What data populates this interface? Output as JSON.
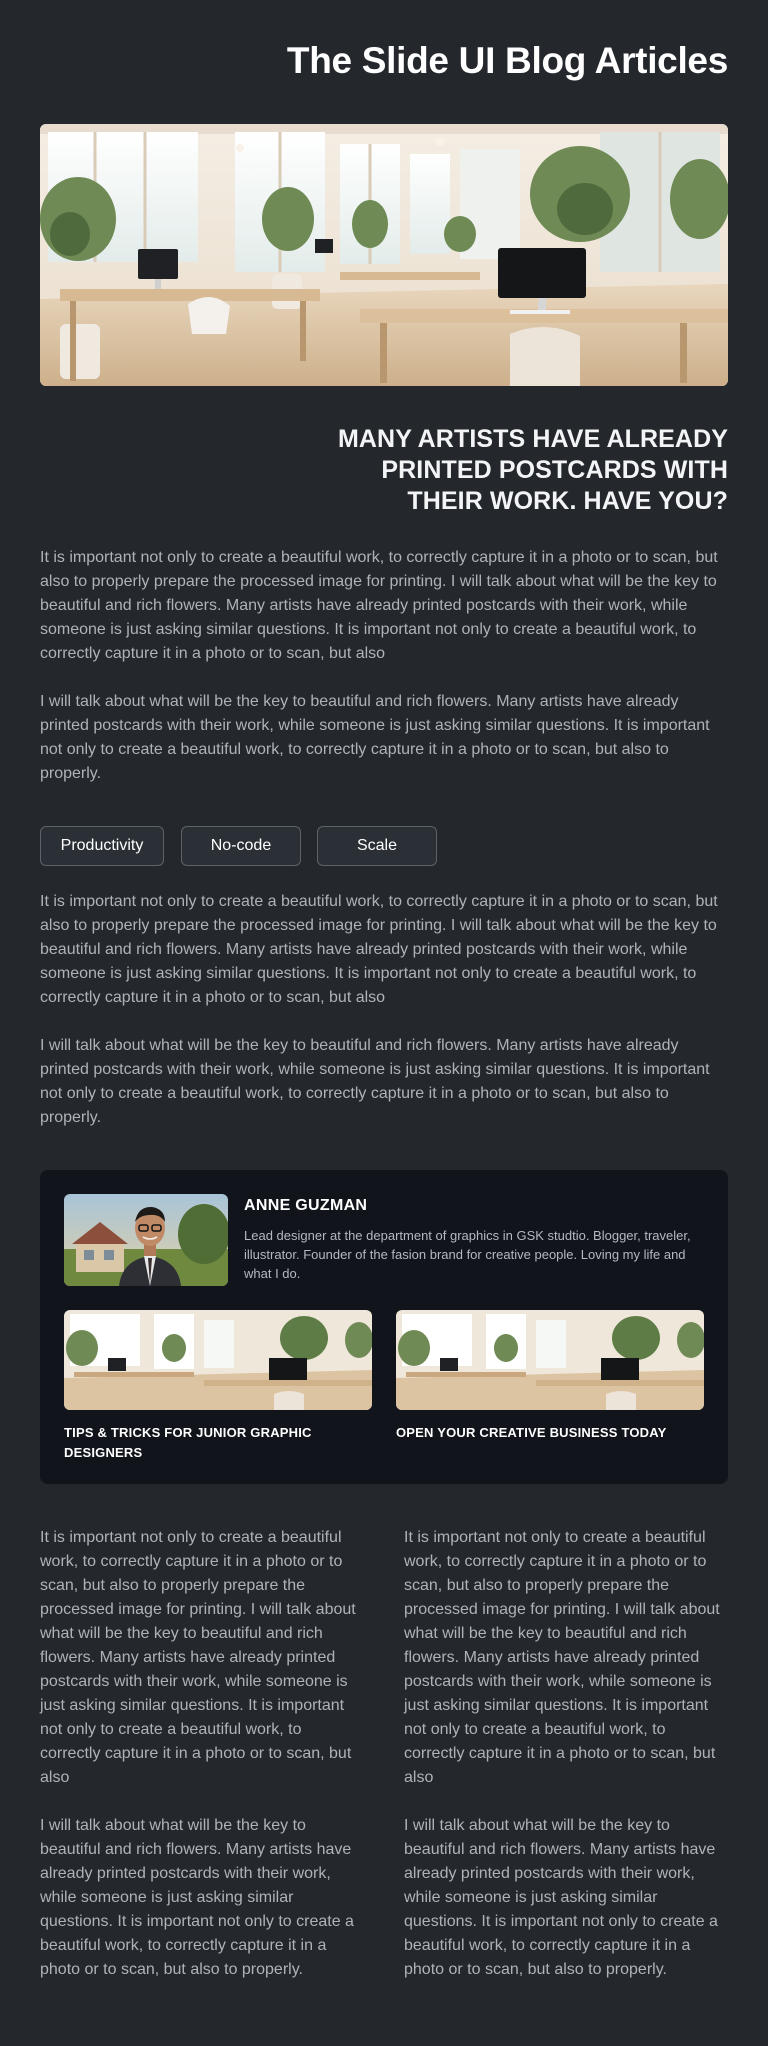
{
  "header": {
    "title": "The Slide UI Blog Articles"
  },
  "hero": {
    "image_name": "office-interior"
  },
  "article": {
    "heading": "MANY ARTISTS HAVE ALREADY PRINTED POSTCARDS WITH THEIR WORK. HAVE YOU?",
    "para1": "It is important not only to create a beautiful work, to correctly capture it in a photo or to scan, but also to properly prepare the processed image for printing. I will talk about what will be the key to beautiful and rich flowers. Many artists have already printed postcards with their work, while someone is just asking similar questions. It is important not only to create a beautiful work, to correctly capture it in a photo or to scan, but also",
    "para2": "I will talk about what will be the key to beautiful and rich flowers. Many artists have already printed postcards with their work, while someone is just asking similar questions. It is important not only to create a beautiful work, to correctly capture it in a photo or to scan, but also to properly.",
    "tags": [
      "Productivity",
      "No-code",
      "Scale"
    ],
    "para3": "It is important not only to create a beautiful work, to correctly capture it in a photo or to scan, but also to properly prepare the processed image for printing. I will talk about what will be the key to beautiful and rich flowers. Many artists have already printed postcards with their work, while someone is just asking similar questions. It is important not only to create a beautiful work, to correctly capture it in a photo or to scan, but also",
    "para4": "I will talk about what will be the key to beautiful and rich flowers. Many artists have already printed postcards with their work, while someone is just asking similar questions. It is important not only to create a beautiful work, to correctly capture it in a photo or to scan, but also to properly."
  },
  "author_card": {
    "name": "ANNE GUZMAN",
    "bio": "Lead designer at the department of graphics in GSK studtio. Blogger, traveler, illustrator. Founder of the fasion brand for creative people. Loving my life and what I do.",
    "related": [
      {
        "title": "TIPS & TRICKS FOR JUNIOR GRAPHIC DESIGNERS"
      },
      {
        "title": "OPEN YOUR CREATIVE BUSINESS TODAY"
      }
    ]
  },
  "columns": {
    "left": {
      "para1": "It is important not only to create a beautiful work, to correctly capture it in a photo or to scan, but also to properly prepare the processed image for printing. I will talk about what will be the key to beautiful and rich flowers. Many artists have already printed postcards with their work, while someone is just asking similar questions. It is important not only to create a beautiful work, to correctly capture it in a photo or to scan, but also",
      "para2": "I will talk about what will be the key to beautiful and rich flowers. Many artists have already printed postcards with their work, while someone is just asking similar questions. It is important not only to create a beautiful work, to correctly capture it in a photo or to scan, but also to properly."
    },
    "right": {
      "para1": "It is important not only to create a beautiful work, to correctly capture it in a photo or to scan, but also to properly prepare the processed image for printing. I will talk about what will be the key to beautiful and rich flowers. Many artists have already printed postcards with their work, while someone is just asking similar questions. It is important not only to create a beautiful work, to correctly capture it in a photo or to scan, but also",
      "para2": "I will talk about what will be the key to beautiful and rich flowers. Many artists have already printed postcards with their work, while someone is just asking similar questions. It is important not only to create a beautiful work, to correctly capture it in a photo or to scan, but also to properly."
    }
  },
  "colors": {
    "background": "#24282d",
    "card": "#11141a",
    "body_text": "#aeb3ba",
    "heading": "#ffffff"
  }
}
